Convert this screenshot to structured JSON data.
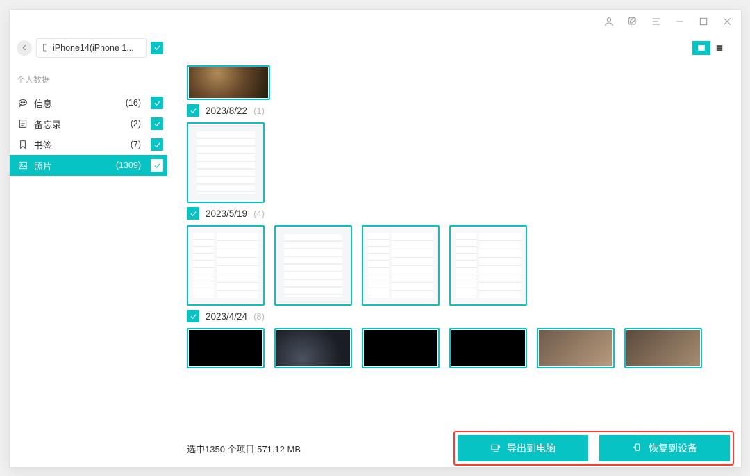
{
  "titlebar": {},
  "device": {
    "name": "iPhone14(iPhone 1..."
  },
  "sidebar": {
    "section_label": "个人数据",
    "items": [
      {
        "label": "信息",
        "count": "(16)",
        "icon": "message",
        "active": false
      },
      {
        "label": "备忘录",
        "count": "(2)",
        "icon": "note",
        "active": false
      },
      {
        "label": "书签",
        "count": "(7)",
        "icon": "bookmark",
        "active": false
      },
      {
        "label": "照片",
        "count": "(1309)",
        "icon": "image",
        "active": true
      }
    ]
  },
  "groups": [
    {
      "date": "2023/8/22",
      "count": "(1)"
    },
    {
      "date": "2023/5/19",
      "count": "(4)"
    },
    {
      "date": "2023/4/24",
      "count": "(8)"
    }
  ],
  "footer": {
    "status": "选中1350 个项目 571.12 MB",
    "export_label": "导出到电脑",
    "restore_label": "恢复到设备"
  }
}
